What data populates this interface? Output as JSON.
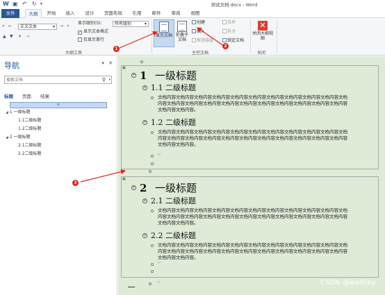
{
  "title_bar": {
    "doc_title": "测试文档.docx - Word"
  },
  "tabs": [
    {
      "label": "文件"
    },
    {
      "label": "大纲"
    },
    {
      "label": "开始"
    },
    {
      "label": "插入"
    },
    {
      "label": "设计"
    },
    {
      "label": "页面布局"
    },
    {
      "label": "引用"
    },
    {
      "label": "邮件"
    },
    {
      "label": "审阅"
    },
    {
      "label": "视图"
    }
  ],
  "ribbon": {
    "outline_tools": {
      "level_select": "正文文本",
      "show_level_label": "显示级别(S):",
      "show_level_value": "所有级别",
      "show_text_format": "显示文本格式",
      "first_line_only": "仅显示首行",
      "group_label": "大纲工具"
    },
    "master_doc": {
      "show_doc": "显示文档",
      "collapse_sub": "折叠子文档",
      "create": "创建",
      "insert": "插入",
      "unlink": "取消链接",
      "merge": "合并",
      "split": "拆分",
      "lock": "锁定文档",
      "group_label": "主控文档"
    },
    "close": {
      "label": "关闭大纲视图",
      "group_label": "关闭"
    }
  },
  "nav": {
    "title": "导航",
    "search_placeholder": "搜索文档",
    "tabs": [
      "标题",
      "页面",
      "结果"
    ],
    "items": [
      {
        "label": "1 一级标题",
        "level": 1
      },
      {
        "label": "1.1二级标题",
        "level": 2
      },
      {
        "label": "1.2二级标题",
        "level": 2
      },
      {
        "label": "2 一级标题",
        "level": 1
      },
      {
        "label": "2.1二级标题",
        "level": 2
      },
      {
        "label": "2.2二级标题",
        "level": 2
      }
    ]
  },
  "doc": {
    "h1_a_num": "1",
    "h1_a_text": "一级标题",
    "h2_a1": "1.1 二级标题",
    "h2_a2": "1.2 二级标题",
    "h1_b_num": "2",
    "h1_b_text": "一级标题",
    "h2_b1": "2.1 二级标题",
    "h2_b2": "2.2 二级标题",
    "body_text": "文档内容文档内容文档内容文档内容文档内容文档内容文档内容文档内容文档内容文档内容文档内容文档内容文档内容文档内容文档内容文档内容文档内容文档内容文档内容文档内容文档内容文档内容文档内容。",
    "para_mark": "↵"
  },
  "annotations": {
    "badge1": "1",
    "badge2": "2",
    "badge3": "3",
    "color": "#e0251b"
  },
  "watermark": "CSDN @wolloky"
}
